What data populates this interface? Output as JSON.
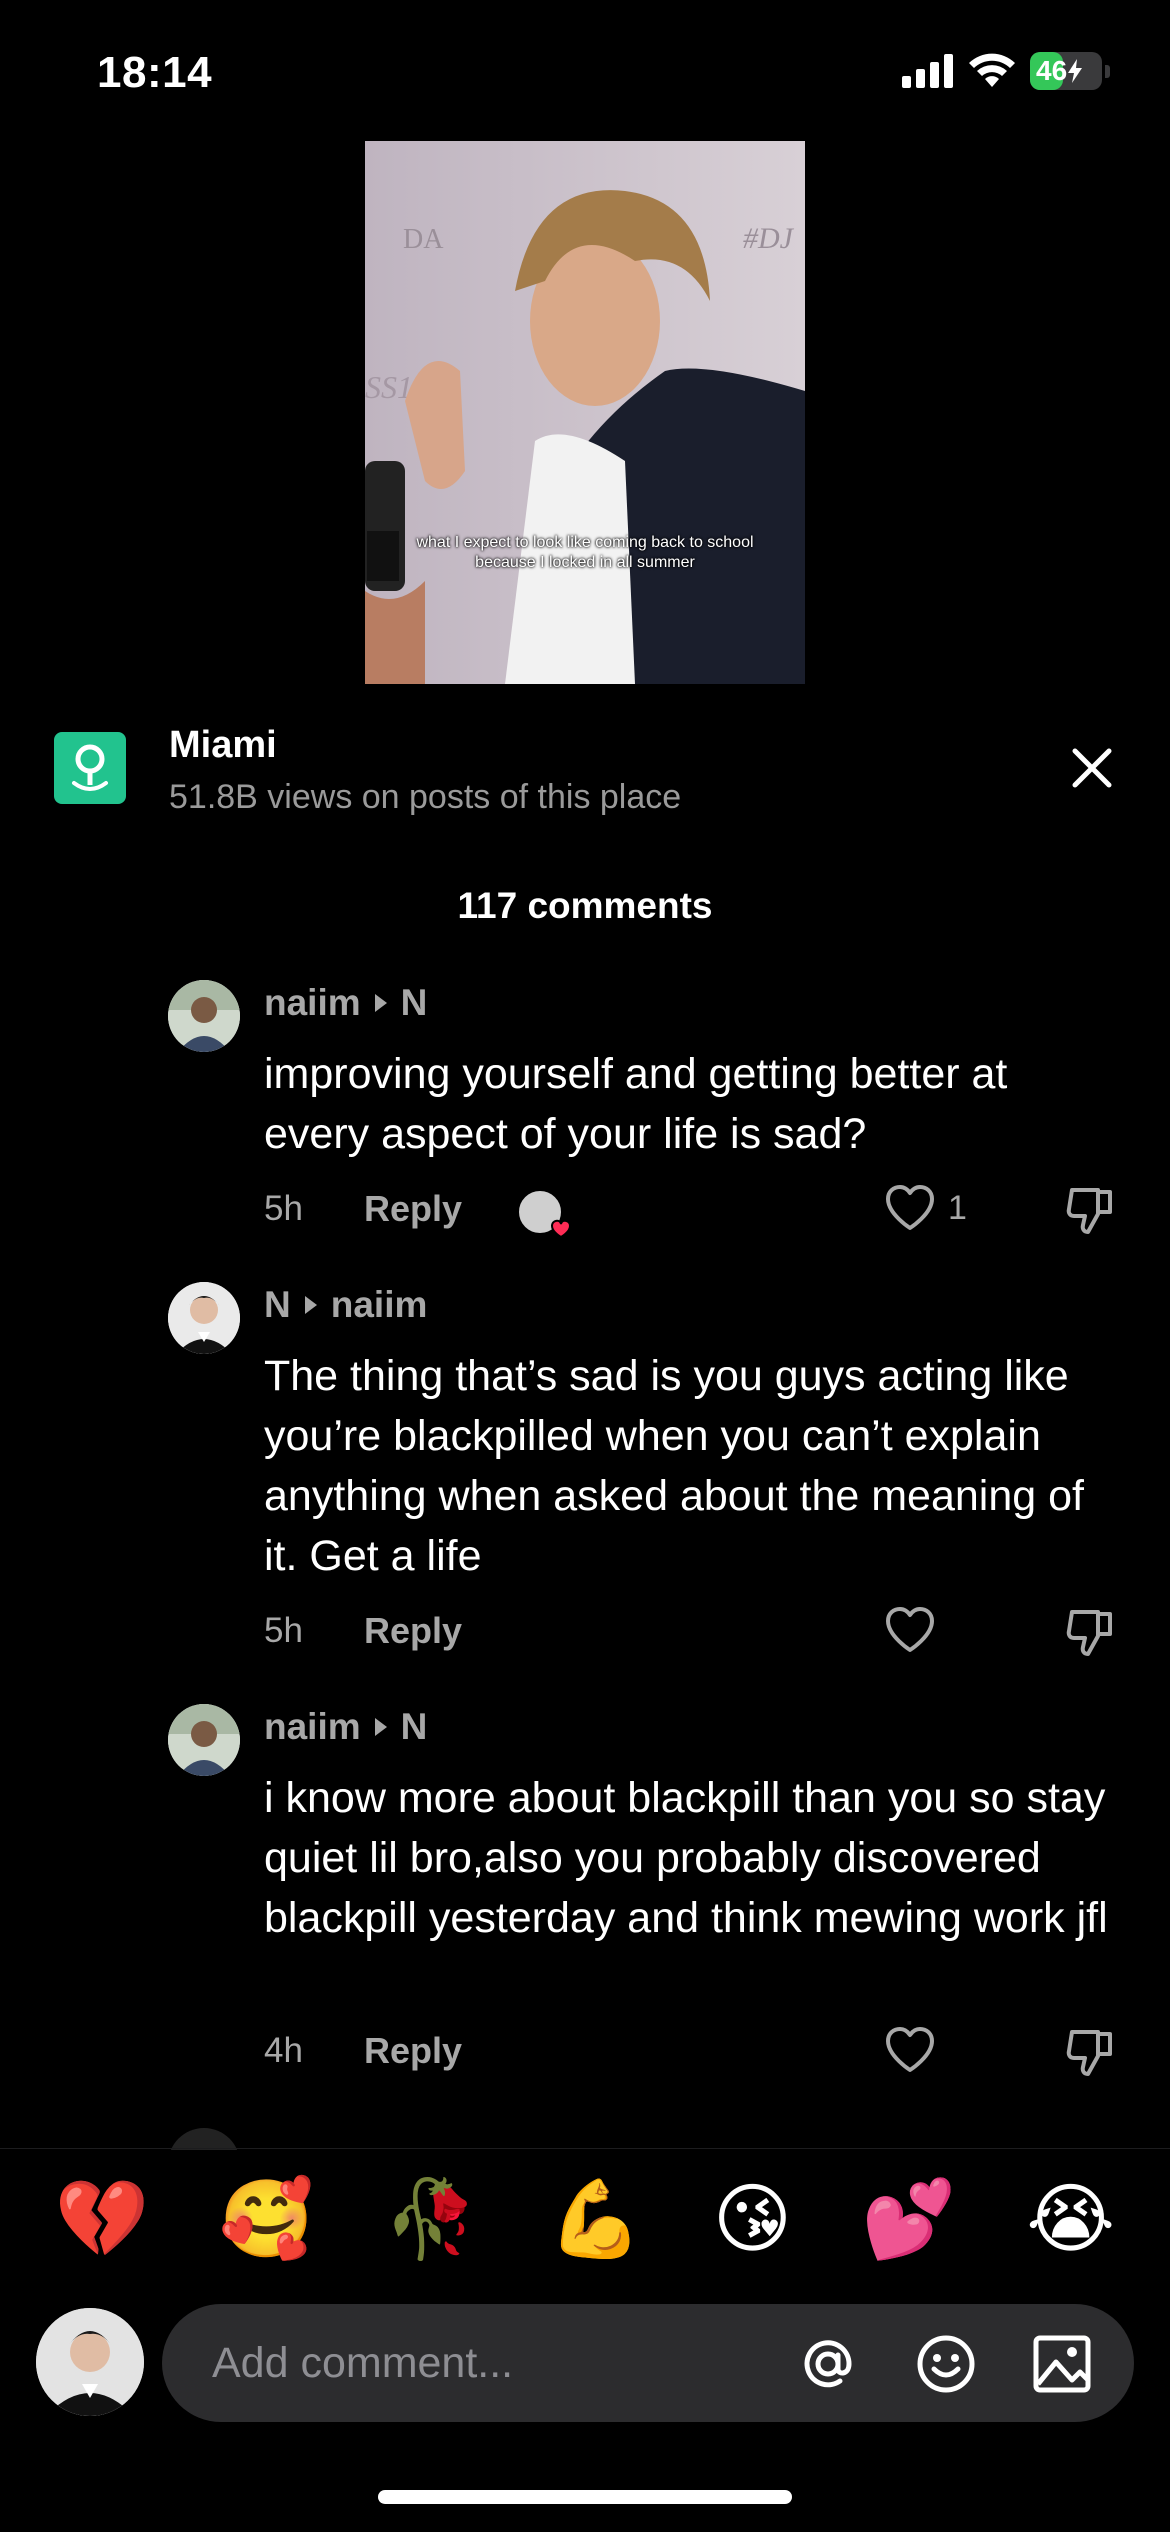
{
  "status_bar": {
    "time": "18:14",
    "battery_level": "46",
    "battery_percent": 46,
    "icons": [
      "cellular-signal-icon",
      "wifi-icon",
      "battery-charging-icon"
    ]
  },
  "video": {
    "caption": "what I expect to look like coming back to school because I locked in all summer"
  },
  "location": {
    "name": "Miami",
    "subtitle": "51.8B views on posts of this place",
    "icon": "location-pin-icon",
    "accent": "#22c38e"
  },
  "comments_header": "117 comments",
  "comments": [
    {
      "author": "naiim",
      "reply_to": "N",
      "text": "improving yourself and getting better at every aspect of your life is sad?",
      "time": "5h",
      "reply_label": "Reply",
      "likes": "1",
      "has_reaction": true
    },
    {
      "author": "N",
      "reply_to": "naiim",
      "text": "The thing that’s sad is you guys acting like you’re blackpilled when you can’t explain anything when asked about the meaning of it. Get a life",
      "time": "5h",
      "reply_label": "Reply",
      "likes": "",
      "has_reaction": false
    },
    {
      "author": "naiim",
      "reply_to": "N",
      "text": "i know more about blackpill than you so stay quiet lil bro,also you probably discovered blackpill yesterday and think mewing work jfl",
      "time": "4h",
      "reply_label": "Reply",
      "likes": "",
      "has_reaction": false
    }
  ],
  "emoji_bar": [
    "💔",
    "🥰",
    "🥀",
    "💪",
    "😘",
    "💕",
    "😭"
  ],
  "input": {
    "placeholder": "Add comment...",
    "icons": [
      "mention-icon",
      "emoji-icon",
      "image-icon"
    ]
  },
  "colors": {
    "background": "#000000",
    "secondary_text": "#a8a8a8",
    "input_bg": "#2c2c2e"
  }
}
